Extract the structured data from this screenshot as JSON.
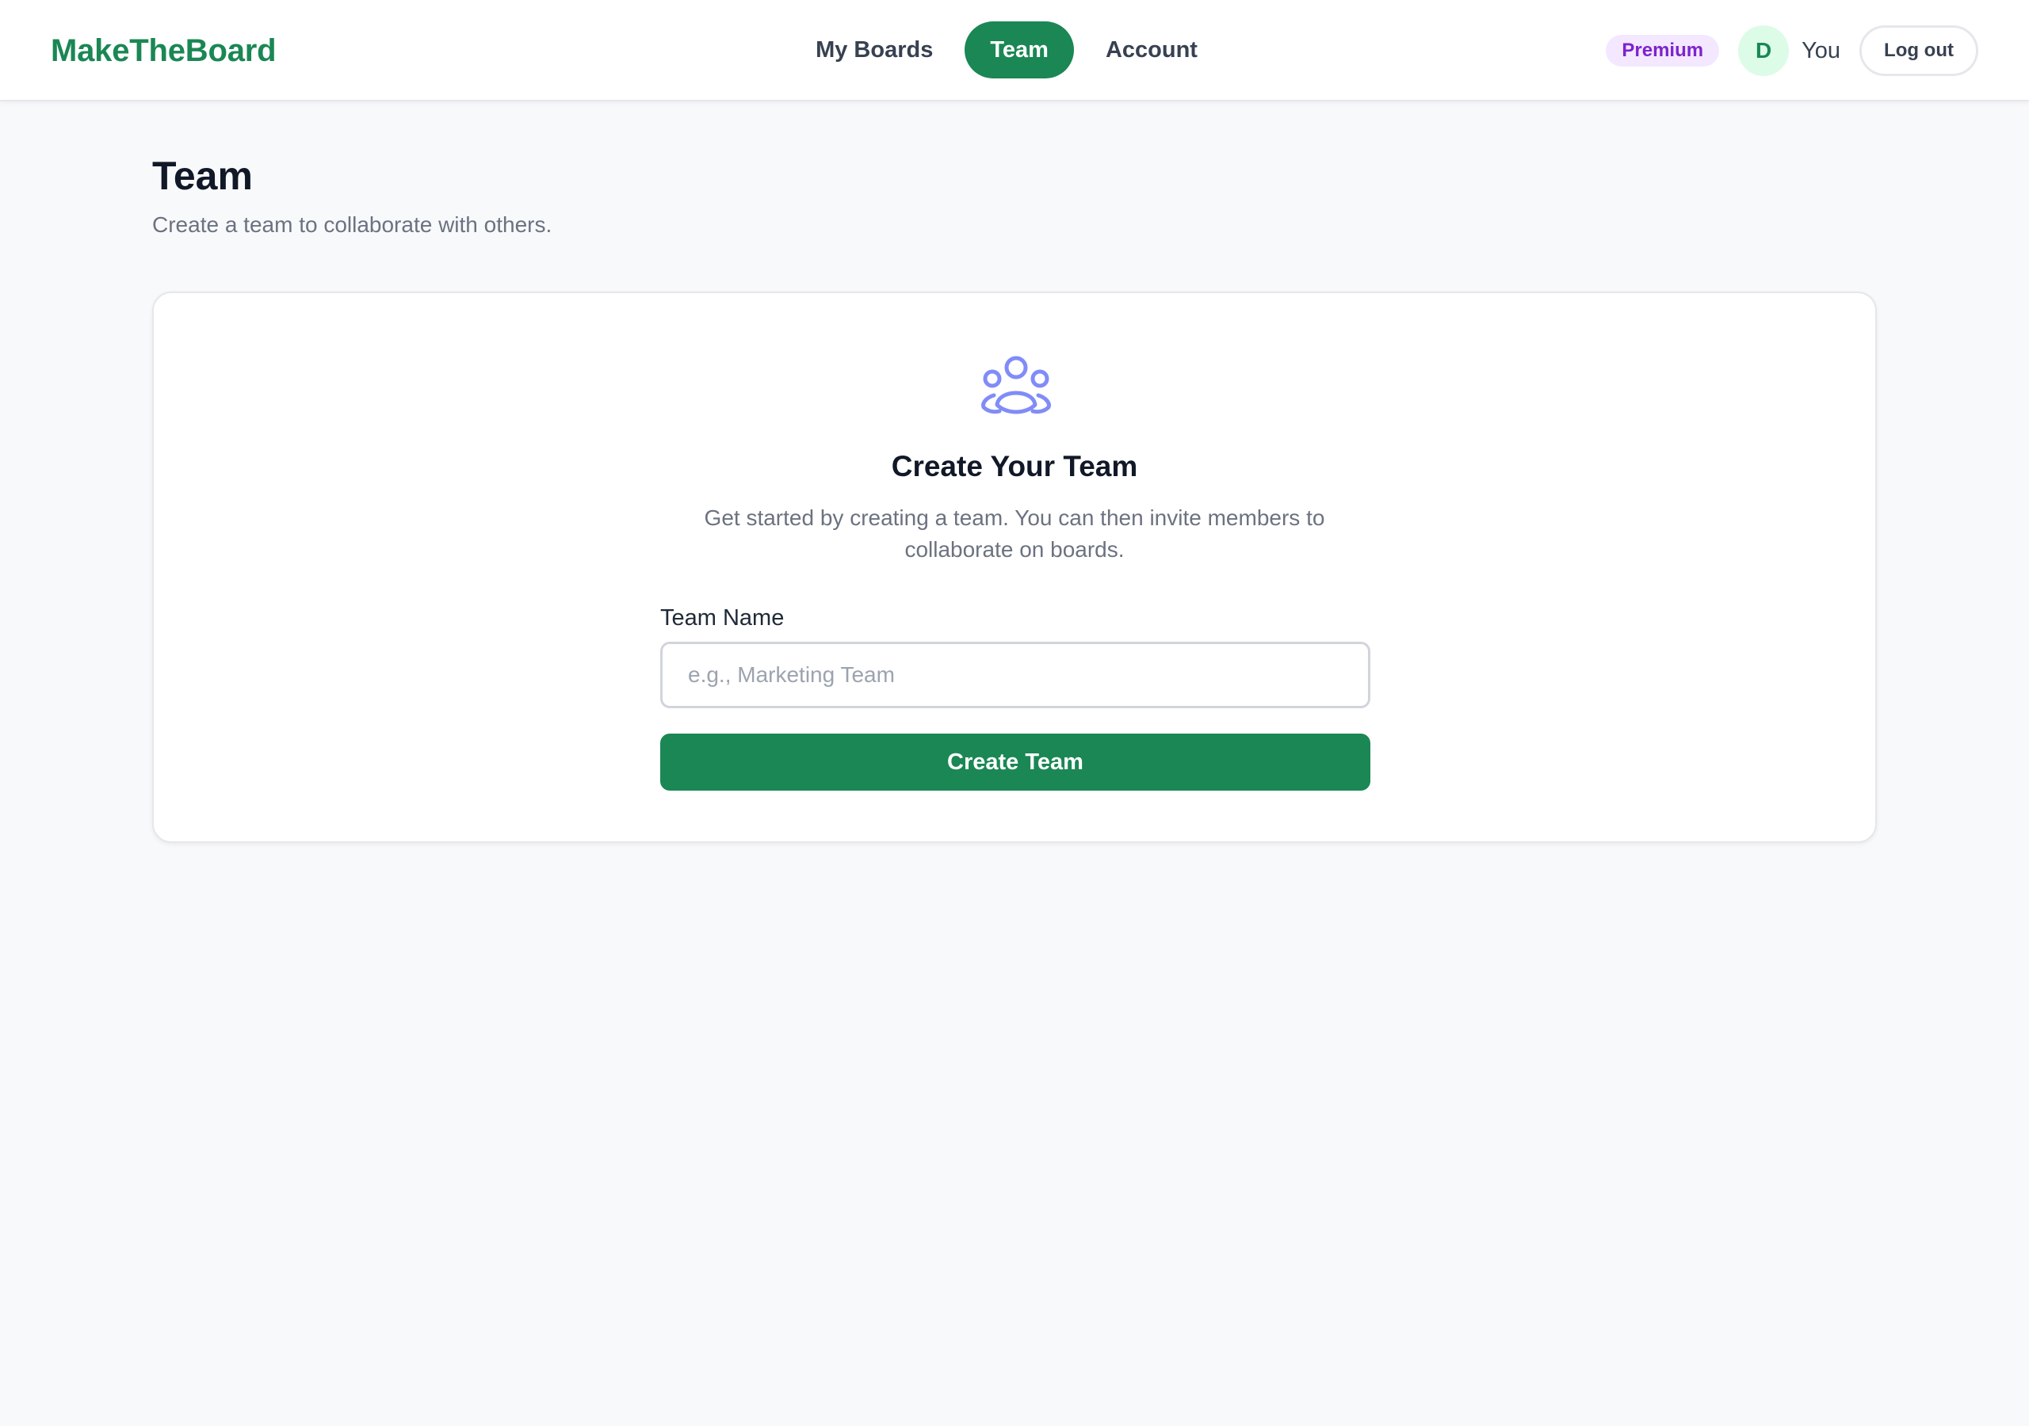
{
  "app": {
    "logo": "MakeTheBoard",
    "accent_color": "#1a8754"
  },
  "nav": {
    "items": [
      {
        "label": "My Boards",
        "active": false
      },
      {
        "label": "Team",
        "active": true
      },
      {
        "label": "Account",
        "active": false
      }
    ]
  },
  "user": {
    "plan_badge": "Premium",
    "avatar_initial": "D",
    "name": "You",
    "logout_label": "Log out"
  },
  "page": {
    "title": "Team",
    "subtitle": "Create a team to collaborate with others."
  },
  "create_team": {
    "icon": "users-group-icon",
    "icon_color": "#818cf8",
    "title": "Create Your Team",
    "description": "Get started by creating a team. You can then invite members to collaborate on boards.",
    "field_label": "Team Name",
    "input_value": "",
    "input_placeholder": "e.g., Marketing Team",
    "submit_label": "Create Team"
  }
}
